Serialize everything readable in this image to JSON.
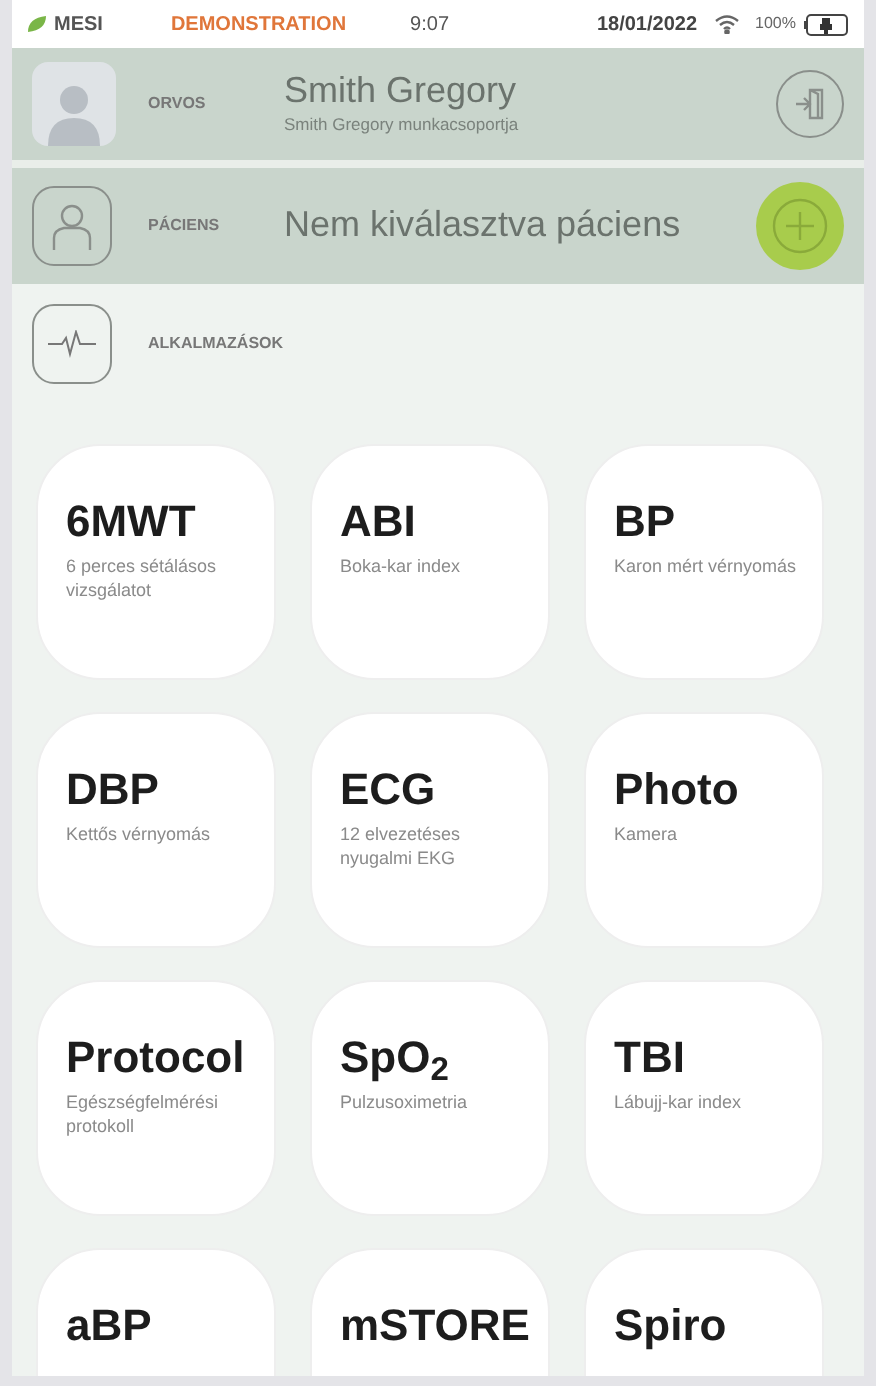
{
  "status_bar": {
    "brand": "MESI",
    "mode": "DEMONSTRATION",
    "time": "9:07",
    "date": "18/01/2022",
    "battery": "100%"
  },
  "doctor": {
    "role": "ORVOS",
    "name": "Smith Gregory",
    "group": "Smith Gregory munkacsoportja"
  },
  "patient": {
    "role": "PÁCIENS",
    "name": "Nem kiválasztva páciens"
  },
  "apps_header": {
    "label": "ALKALMAZÁSOK"
  },
  "apps": [
    {
      "title": "6MWT",
      "subtitle": "6 perces sétálásos vizsgálatot"
    },
    {
      "title": "ABI",
      "subtitle": "Boka-kar index"
    },
    {
      "title": "BP",
      "subtitle": "Karon mért vérnyomás"
    },
    {
      "title": "DBP",
      "subtitle": "Kettős vérnyomás"
    },
    {
      "title": "ECG",
      "subtitle": "12 elvezetéses nyugalmi EKG"
    },
    {
      "title": "Photo",
      "subtitle": "Kamera"
    },
    {
      "title": "Protocol",
      "subtitle": "Egészségfelmérési protokoll"
    },
    {
      "title": "SpO$_{2}$",
      "subtitle": "Pulzusoximetria"
    },
    {
      "title": "TBI",
      "subtitle": "Lábujj-kar index"
    },
    {
      "title": "aBP"
    },
    {
      "title": "mSTORE"
    },
    {
      "title": "Spiro"
    }
  ]
}
